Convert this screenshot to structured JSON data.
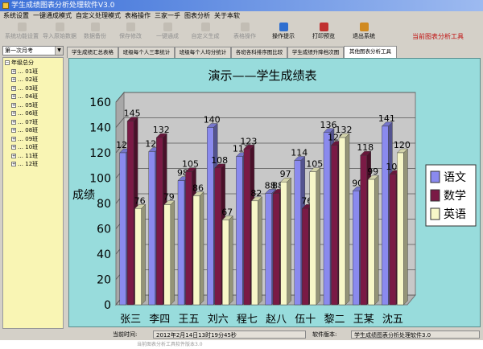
{
  "window": {
    "title": "学生成绩图表分析处理软件V3.0"
  },
  "menu": [
    "系统设置",
    "一键通成模式",
    "自定义处理模式",
    "表格操作",
    "三家一乎",
    "图表分析",
    "关于本软"
  ],
  "toolbar": {
    "buttons": [
      {
        "label": "系统功能设置",
        "state": "disabled"
      },
      {
        "label": "导入原始数据",
        "state": "disabled"
      },
      {
        "label": "数据备份",
        "state": "disabled"
      },
      {
        "label": "保存修改",
        "state": "disabled"
      },
      {
        "label": "一键通成",
        "state": "disabled"
      },
      {
        "label": "自定义生成",
        "state": "disabled"
      },
      {
        "label": "表格操作",
        "state": "disabled"
      },
      {
        "label": "操作提示",
        "state": "enabled",
        "icon_color": "#2f6fd0"
      },
      {
        "label": "打印预览",
        "state": "enabled",
        "icon_color": "#c03030"
      },
      {
        "label": "退出系统",
        "state": "enabled",
        "icon_color": "#d08a20"
      }
    ],
    "right_link": "当前图表分析工具"
  },
  "sidebar": {
    "combo_value": "第一次月考",
    "tree_root": "年级总分",
    "tree_children": [
      "01班",
      "02班",
      "03班",
      "04班",
      "05班",
      "06班",
      "07班",
      "08班",
      "09班",
      "10班",
      "11班",
      "12班"
    ]
  },
  "tabs": [
    {
      "label": "学生成绩汇总表格",
      "active": false
    },
    {
      "label": "班级每个人三率统计",
      "active": false
    },
    {
      "label": "班级每个人均分统计",
      "active": false
    },
    {
      "label": "各班各科排序图比较",
      "active": false
    },
    {
      "label": "学生成绩升降档次图",
      "active": false
    },
    {
      "label": "其他图表分析工具",
      "active": true
    }
  ],
  "status": {
    "time_label": "当前时间:",
    "time_value": "2012年2月14日13时19分45秒",
    "version_label": "软件版本:",
    "version_value": "学生成绩图表分析处理软件3.0"
  },
  "footer_text": "当前图表分析工具软件版本3.0",
  "colors": {
    "chart_bg": "#98dcdc",
    "wall": "#c8c8c8",
    "floor": "#b4b4b4"
  },
  "chart_data": {
    "type": "bar",
    "title": "演示——学生成绩表",
    "xlabel": "",
    "ylabel": "成绩",
    "ylim": [
      0,
      160
    ],
    "yticks": [
      0,
      20,
      40,
      60,
      80,
      100,
      120,
      140,
      160
    ],
    "grid": true,
    "legend_position": "right",
    "categories": [
      "张三",
      "李四",
      "王五",
      "刘六",
      "程七",
      "赵八",
      "伍十",
      "黎二",
      "王某",
      "沈五"
    ],
    "series": [
      {
        "name": "语文",
        "color": "#8a8aee",
        "values": [
          120,
          121,
          98,
          140,
          117,
          88,
          114,
          136,
          90,
          141
        ]
      },
      {
        "name": "数学",
        "color": "#7a1a45",
        "values": [
          145,
          132,
          105,
          108,
          123,
          88,
          76,
          126,
          118,
          103
        ]
      },
      {
        "name": "英语",
        "color": "#f7f7c8",
        "values": [
          76,
          79,
          86,
          67,
          82,
          97,
          105,
          132,
          99,
          120
        ]
      }
    ]
  }
}
